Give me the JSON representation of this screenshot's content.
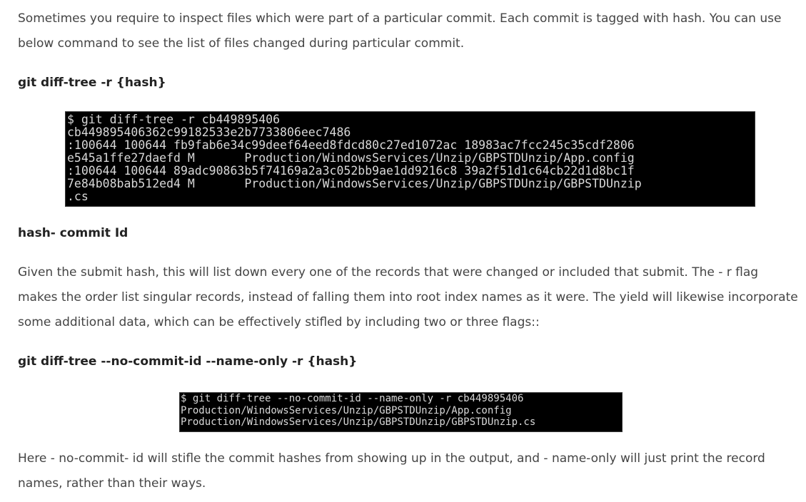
{
  "intro": "Sometimes you require to inspect files which were part of a particular commit. Each commit is tagged with hash. You can use below command to see the list of files changed during particular commit.",
  "command1_heading": "git diff-tree -r {hash}",
  "terminal1": {
    "lines": [
      "$ git diff-tree -r cb449895406",
      "cb449895406362c99182533e2b7733806eec7486",
      ":100644 100644 fb9fab6e34c99deef64eed8fdcd80c27ed1072ac 18983ac7fcc245c35cdf2806",
      "e545a1ffe27daefd M       Production/WindowsServices/Unzip/GBPSTDUnzip/App.config",
      ":100644 100644 89adc90863b5f74169a2a3c052bb9ae1dd9216c8 39a2f51d1c64cb22d1d8bc1f",
      "7e84b08bab512ed4 M       Production/WindowsServices/Unzip/GBPSTDUnzip/GBPSTDUnzip",
      ".cs"
    ]
  },
  "hash_heading": "hash- commit Id",
  "description": "Given the submit hash, this will list down every one of the records that were changed or included that submit. The - r flag makes the order list singular records, instead of falling them into root index names as it were. The yield will likewise incorporate some additional data, which can be effectively stifled by including two or three flags::",
  "command2_heading": "git diff-tree --no-commit-id --name-only -r {hash}",
  "terminal2": {
    "lines": [
      "$ git diff-tree --no-commit-id --name-only -r cb449895406",
      "Production/WindowsServices/Unzip/GBPSTDUnzip/App.config",
      "Production/WindowsServices/Unzip/GBPSTDUnzip/GBPSTDUnzip.cs"
    ]
  },
  "outro": "Here - no-commit- id will stifle the commit hashes from showing up in the output, and - name-only will just print the record names, rather than their ways."
}
